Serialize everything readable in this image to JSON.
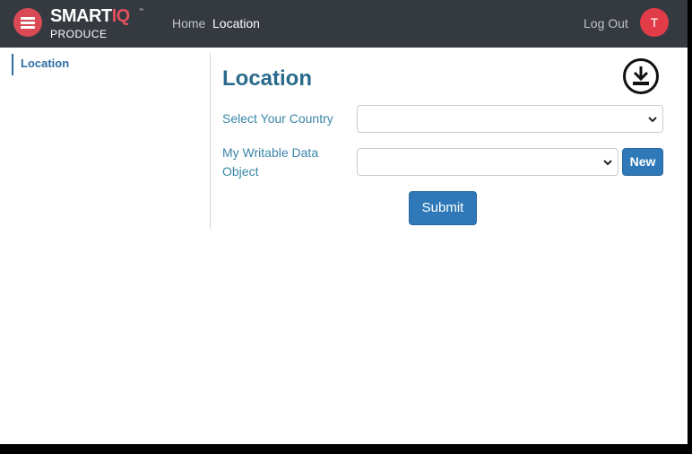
{
  "header": {
    "brand": {
      "name_main": "SMART",
      "name_accent": "IQ",
      "trademark": "™",
      "product": "PRODUCE"
    },
    "nav": {
      "home": "Home",
      "current": "Location"
    },
    "logout": "Log Out",
    "avatar_initial": "T"
  },
  "sidebar": {
    "items": [
      {
        "label": "Location",
        "active": true
      }
    ]
  },
  "main": {
    "title": "Location",
    "fields": {
      "country": {
        "label": "Select Your Country",
        "value": ""
      },
      "data_object": {
        "label": "My Writable Data Object",
        "value": ""
      }
    },
    "new_button": "New",
    "submit_button": "Submit"
  },
  "icons": [
    "hamburger-icon",
    "download-icon",
    "chevron-down-icon"
  ],
  "colors": {
    "topbar": "#353a41",
    "accent_red": "#e23c48",
    "primary_blue": "#2f79b9",
    "title_teal": "#2a6b8c"
  }
}
